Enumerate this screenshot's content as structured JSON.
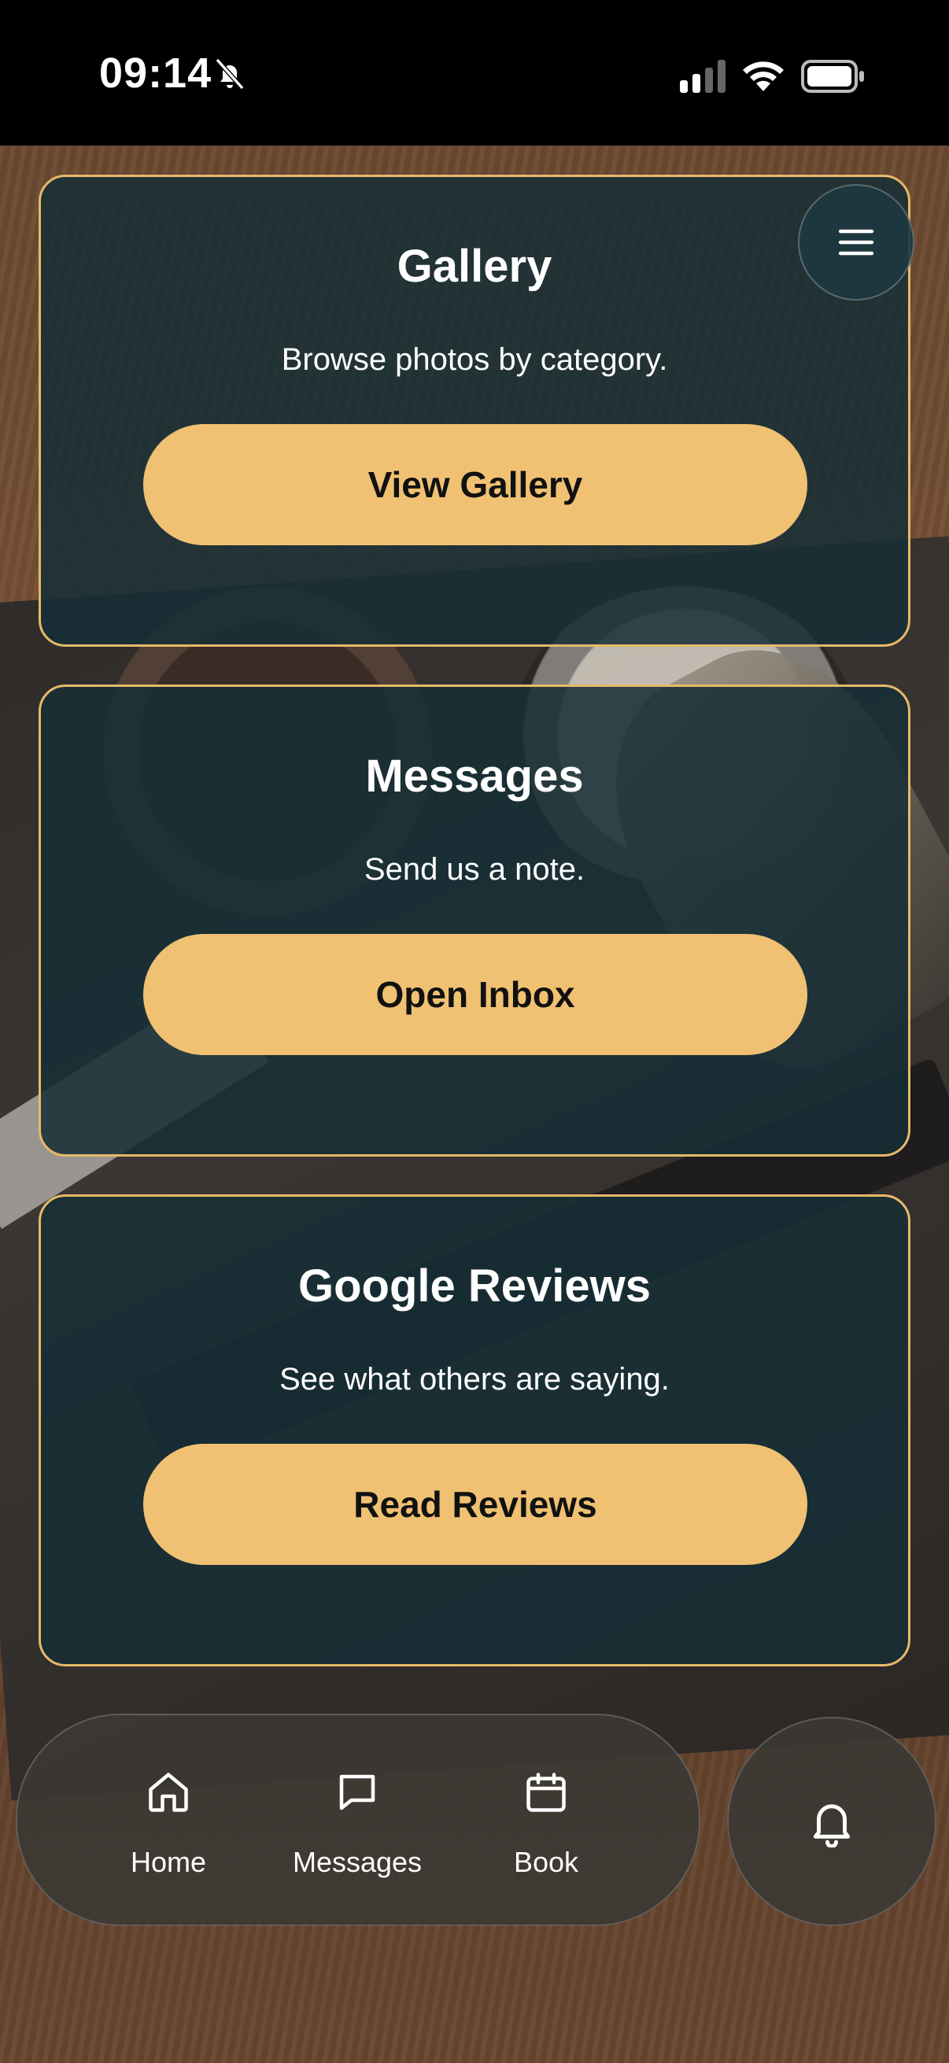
{
  "status_bar": {
    "time": "09:14"
  },
  "cards": {
    "gallery": {
      "title": "Gallery",
      "description": "Browse photos by category.",
      "button": "View Gallery"
    },
    "messages": {
      "title": "Messages",
      "description": "Send us a note.",
      "button": "Open Inbox"
    },
    "reviews": {
      "title": "Google Reviews",
      "description": "See what others are saying.",
      "button": "Read Reviews"
    }
  },
  "bottom_nav": {
    "home": "Home",
    "messages": "Messages",
    "book": "Book"
  },
  "colors": {
    "accent": "#f0c172",
    "card_border": "#e7b969",
    "card_bg": "#162e36"
  },
  "icons": {
    "menu": "hamburger-icon",
    "home": "home-icon",
    "messages": "chat-bubble-icon",
    "book": "calendar-icon",
    "notifications": "bell-icon",
    "silent": "bell-slash-icon"
  }
}
